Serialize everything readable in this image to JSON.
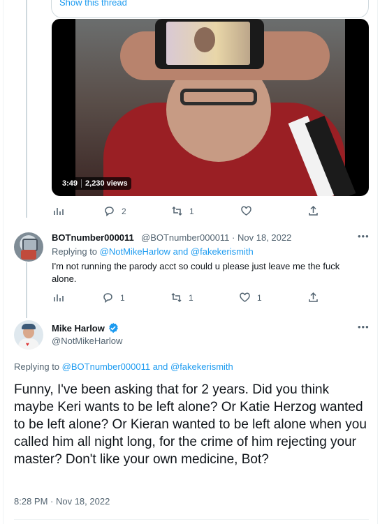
{
  "quoted": {
    "show_thread": "Show this thread"
  },
  "media": {
    "duration": "3:49",
    "views": "2,230 views"
  },
  "actions_top": {
    "views": "",
    "replies": "2",
    "retweets": "1",
    "likes": "",
    "share": ""
  },
  "reply_tweet": {
    "name": "BOTnumber000011",
    "handle": "@BOTnumber000011",
    "dot": "·",
    "date": "Nov 18, 2022",
    "replying_label": "Replying to",
    "replying_handles": "@NotMikeHarlow and @fakekerismith",
    "text": "I'm not running the parody acct so could u please just leave me the fuck alone.",
    "actions": {
      "replies": "1",
      "retweets": "1",
      "likes": "1"
    }
  },
  "main_tweet": {
    "name": "Mike Harlow",
    "handle": "@NotMikeHarlow",
    "replying_label": "Replying to",
    "replying_handles": "@BOTnumber000011 and @fakekerismith",
    "text": "Funny, I've been asking that for 2 years. Did you think maybe Keri wants to be left alone? Or Katie Herzog wanted to be left alone? Or Kieran wanted to be left alone when you called him all night long, for the crime of him rejecting your master? Don't like your own medicine, Bot?",
    "timestamp": "8:28 PM · Nov 18, 2022"
  },
  "icons": {
    "views": "bar-chart-icon",
    "reply": "speech-bubble-icon",
    "retweet": "retweet-icon",
    "like": "heart-icon",
    "share": "share-icon",
    "more": "more-icon",
    "verified": "verified-badge-icon"
  },
  "colors": {
    "link": "#1d9bf0",
    "muted": "#536471",
    "text": "#0f1419"
  }
}
